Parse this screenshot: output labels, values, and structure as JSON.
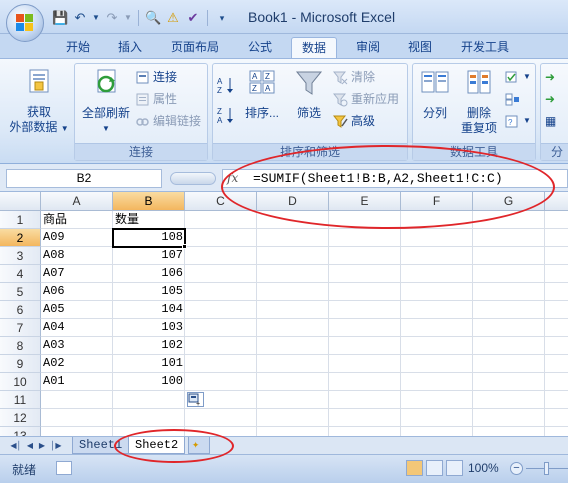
{
  "window": {
    "title": "Book1 - Microsoft Excel"
  },
  "ribbon_tabs": [
    "开始",
    "插入",
    "页面布局",
    "公式",
    "数据",
    "审阅",
    "视图",
    "开发工具"
  ],
  "active_tab": "数据",
  "ribbon": {
    "get_external": {
      "line1": "获取",
      "line2": "外部数据"
    },
    "refresh_all": "全部刷新",
    "connections": "连接",
    "properties": "属性",
    "edit_links": "编辑链接",
    "connections_group": "连接",
    "sort": "排序...",
    "filter": "筛选",
    "clear": "清除",
    "reapply": "重新应用",
    "advanced": "高级",
    "sort_filter_group": "排序和筛选",
    "text_to_columns": "分列",
    "remove_dup": {
      "line1": "删除",
      "line2": "重复项"
    },
    "data_tools_group": "数据工具",
    "partial_group": "分"
  },
  "formula_bar": {
    "name_box": "B2",
    "fx_label": "fx",
    "formula": "=SUMIF(Sheet1!B:B,A2,Sheet1!C:C)"
  },
  "columns": [
    "A",
    "B",
    "C",
    "D",
    "E",
    "F",
    "G"
  ],
  "rows": [
    "1",
    "2",
    "3",
    "4",
    "5",
    "6",
    "7",
    "8",
    "9",
    "10",
    "11",
    "12",
    "13"
  ],
  "cells": {
    "A1": "商品",
    "B1": "数量",
    "A2": "A09",
    "B2": "108",
    "A3": "A08",
    "B3": "107",
    "A4": "A07",
    "B4": "106",
    "A5": "A06",
    "B5": "105",
    "A6": "A05",
    "B6": "104",
    "A7": "A04",
    "B7": "103",
    "A8": "A03",
    "B8": "102",
    "A9": "A02",
    "B9": "101",
    "A10": "A01",
    "B10": "100"
  },
  "active_cell": "B2",
  "sheet_tabs": [
    "Sheet1",
    "Sheet2"
  ],
  "active_sheet": "Sheet2",
  "status": {
    "ready": "就绪",
    "zoom": "100%"
  },
  "colors": {
    "annotation": "#e0262a",
    "selected_header": "#f3b65e",
    "accent": "#15428b"
  }
}
